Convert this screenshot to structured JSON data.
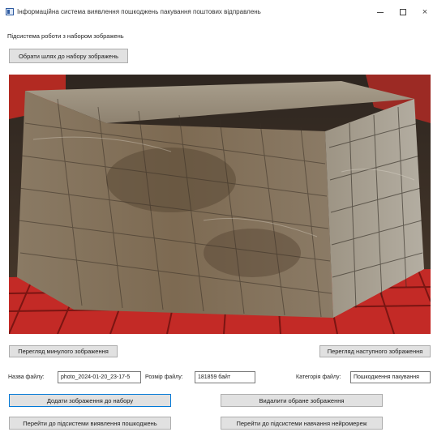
{
  "window": {
    "title": "Інформаційна система виявлення пошкоджень пакування поштових відправлень",
    "minimize": "",
    "maximize": "",
    "close": "×"
  },
  "subsystem": {
    "label": "Підсистема роботи з набором зображень",
    "choose_path_button": "Обрати шлях до набору зображень"
  },
  "image_viewer": {
    "icon": "parcel-photo",
    "prev_button": "Перегляд минулого зображення",
    "next_button": "Перегляд наступного зображення"
  },
  "file_info": {
    "name_label": "Назва файлу:",
    "name_value": "photo_2024-01-20_23-17-5",
    "size_label": "Розмір файлу:",
    "size_value": "181859 байт",
    "category_label": "Категорія файлу:",
    "category_value": "Пошкодження пакування"
  },
  "actions": {
    "add_button": "Додати зображення до набору",
    "delete_button": "Видалити обране зображення",
    "goto_detection_button": "Перейти до підсистеми виявлення пошкоджень",
    "goto_training_button": "Перейти до підсистеми навчання нейромереж"
  }
}
